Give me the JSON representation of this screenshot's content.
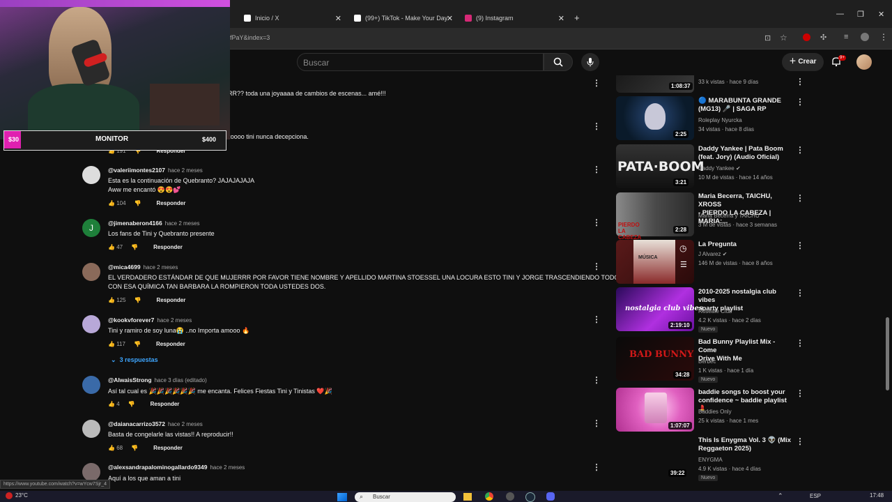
{
  "browser": {
    "tabs": [
      {
        "label": "Inicio / X",
        "fav_color": "#000000"
      },
      {
        "label": "(99+) TikTok - Make Your Day",
        "fav_color": "#111111"
      },
      {
        "label": "(9) Instagram",
        "fav_color": "#d62976"
      }
    ],
    "new_tab": "+",
    "url_fragment": "fPaY&index=3",
    "status_url": "https://www.youtube.com/watch?v=wYcw7Sjr_4"
  },
  "header": {
    "search_placeholder": "Buscar",
    "create_label": "Crear",
    "notif_count": "9+"
  },
  "stream_overlay": {
    "goal_current": "$30",
    "goal_label": "MONITOR",
    "goal_target": "$400",
    "goal_progress": 0.075
  },
  "comments": [
    {
      "text": "RR?? toda una joyaaaa de cambios de escenas... amé!!!"
    },
    {
      "text": "Tini de pelo negro y corto se ve divina amazoooo tini nunca decepciona.",
      "likes": "191",
      "reply": "Responder"
    },
    {
      "user": "@valeriimontes2107",
      "time": "hace 2 meses",
      "text1": "Esta es la continuación de Quebranto? JAJAJAJAJA",
      "text2": "Aww me encantó 😍😍💕",
      "likes": "104",
      "reply": "Responder",
      "avatar_letter": ""
    },
    {
      "user": "@jimenaberon4166",
      "time": "hace 2 meses",
      "text1": "Los fans de Tini y Quebranto presente",
      "likes": "47",
      "reply": "Responder",
      "avatar_letter": "J"
    },
    {
      "user": "@mica4699",
      "time": "hace 2 meses",
      "text1": "EL VERDADERO ESTÁNDAR DE QUE MUJERRR POR FAVOR TIENE NOMBRE Y APELLIDO MARTINA STOESSEL UNA LOCURA ESTO TINI Y JORGE TRASCENDIENDO TODO",
      "text2": "CON ESA QUÍMICA TAN BARBARA LA ROMPIERON TODA USTEDES DOS.",
      "likes": "125",
      "reply": "Responder"
    },
    {
      "user": "@kookvforever7",
      "time": "hace 2 meses",
      "text1": "Tini y ramiro de soy luna😭 ..no Importa amooo 🔥",
      "likes": "117",
      "reply": "Responder",
      "replies": "3 respuestas"
    },
    {
      "user": "@AlwaisStrong",
      "time": "hace 3 días (editado)",
      "text1": "Así tal cual es 🎉🎉🎉🎉🎉🎉 me encanta. Felices Fiestas Tini y Tinistas ❤️🎉",
      "likes": "4",
      "reply": "Responder"
    },
    {
      "user": "@daianacarrizo3572",
      "time": "hace 2 meses",
      "text1": "Basta de congelarle las vistas!! A reproducir!!",
      "likes": "68",
      "reply": "Responder"
    },
    {
      "user": "@alexsandrapalominogallardo9349",
      "time": "hace 2 meses",
      "text1": "Aquí a los que aman a tini"
    }
  ],
  "sidebar": [
    {
      "duration": "1:08:37",
      "meta": "33 k vistas · hace 9 días",
      "colors": [
        "#1a1a1a",
        "#3a3a3a"
      ]
    },
    {
      "title1": "🔵 MARABUNTA GRANDE",
      "title2": "(MG13) 🎤 | SAGA RP",
      "channel": "Roleplay Nyurcka",
      "meta": "34 vistas · hace 8 días",
      "duration": "2:25",
      "colors": [
        "#0a1a2a",
        "#2a4a7a"
      ]
    },
    {
      "title1": "Daddy Yankee | Pata Boom",
      "title2": "(feat. Jory) (Audio Oficial)",
      "channel": "Daddy Yankee",
      "meta": "10 M de vistas · hace 14 años",
      "duration": "3:21",
      "thumb_text": "PATA·BOOM",
      "colors": [
        "#111111",
        "#555555"
      ]
    },
    {
      "title1": "Maria Becerra, TAICHU, XROSS",
      "title2": "- PIERDO LA CABEZA | MARIA:...",
      "channel": "Maria Becerra y TAICHU",
      "meta": "3 M de vistas · hace 3 semanas",
      "duration": "2:28",
      "thumb_text": "PIERDO LA CABEZA",
      "colors": [
        "#6a6a6a",
        "#2a2a2a"
      ]
    },
    {
      "title1": "La Pregunta",
      "channel": "J Alvarez",
      "meta": "146 M de vistas · hace 8 años",
      "thumb_text": "MÚSICA",
      "colors": [
        "#3a0a0a",
        "#7a2a2a"
      ]
    },
    {
      "title1": "2010-2025 nostalgia club vibes",
      "title2": "~party playlist",
      "channel": "Roseate Club",
      "meta": "4.2 K vistas · hace 2 días",
      "badge": "Nuevo",
      "duration": "2:19:10",
      "thumb_text": "nostalgia club vibes",
      "colors": [
        "#2a0a5a",
        "#b030e0"
      ]
    },
    {
      "title1": "Bad Bunny Playlist Mix - Come",
      "title2": "Drive With Me",
      "channel": "Berbec",
      "meta": "1 K vistas · hace 1 día",
      "badge": "Nuevo",
      "duration": "34:28",
      "thumb_text": "BAD BUNNY",
      "colors": [
        "#0a0a0a",
        "#3a0a0a"
      ]
    },
    {
      "title1": "baddie songs to boost your",
      "title2": "confidence ~ baddie playlist 💄",
      "channel": "Baddies Only",
      "meta": "25 k vistas · hace 1 mes",
      "duration": "1:07:07",
      "colors": [
        "#e060c0",
        "#ff99e0"
      ]
    },
    {
      "title1": "This Is Enygma Vol. 3 👽 (Mix",
      "title2": "Reggaeton 2025)",
      "channel": "ENYGMA",
      "meta": "4.9 K vistas · hace 4 días",
      "badge": "Nuevo",
      "duration": "39:22",
      "colors": [
        "#0f0f0f",
        "#0f0f0f"
      ]
    }
  ],
  "taskbar": {
    "weather": "23°C",
    "search": "Buscar",
    "lang": "ESP",
    "time": "17:48"
  }
}
